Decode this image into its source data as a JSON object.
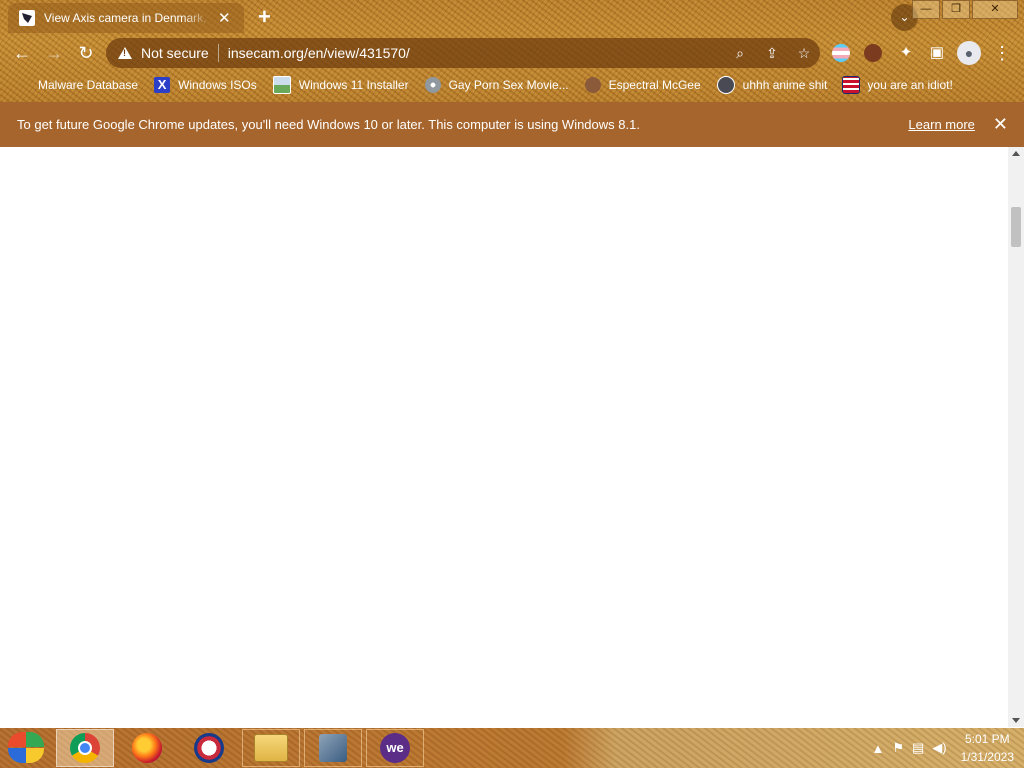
{
  "tab": {
    "title": "View Axis camera in Denmark, Tr",
    "close": "✕",
    "new_tab": "+"
  },
  "window": {
    "minimize": "—",
    "restore": "❐",
    "close": "✕"
  },
  "toolbar": {
    "back": "←",
    "forward": "→",
    "reload": "↻",
    "security_label": "Not secure",
    "url": "insecam.org/en/view/431570/",
    "menu": "⋮"
  },
  "bookmarks": [
    {
      "label": "Malware Database",
      "icon": "none",
      "color": ""
    },
    {
      "label": "Windows ISOs",
      "icon": "x-icon",
      "color": "#2b3fc8"
    },
    {
      "label": "Windows 11 Installer",
      "icon": "image-icon",
      "color": "#6aa85a"
    },
    {
      "label": "Gay Porn Sex Movie...",
      "icon": "disk-icon",
      "color": "#9098a0"
    },
    {
      "label": "Espectral McGee",
      "icon": "face-icon",
      "color": "#8a5a3a"
    },
    {
      "label": "uhhh anime shit",
      "icon": "anime-icon",
      "color": "#4a4a55"
    },
    {
      "label": "you are an idiot!",
      "icon": "flag-icon",
      "color": "#c8102e"
    }
  ],
  "infobar": {
    "message": "To get future Google Chrome updates, you'll need Windows 10 or later. This computer is using Windows 8.1.",
    "link": "Learn more",
    "close": "✕"
  },
  "taskbar": {
    "apps": [
      "chrome",
      "firefox",
      "opera",
      "file-explorer",
      "network",
      "we"
    ],
    "we_label": "we",
    "time": "5:01 PM",
    "date": "1/31/2023"
  },
  "colors": {
    "infobar_bg": "#a6652c",
    "frame": "#b97d2a"
  }
}
